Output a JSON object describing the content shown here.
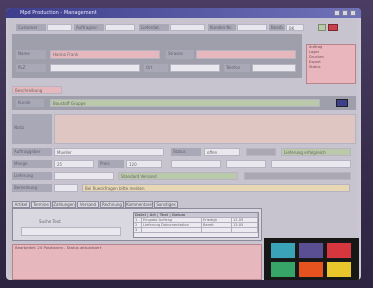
{
  "window": {
    "title": "Mpd Production - Management"
  },
  "top_row": {
    "c1_label": "Customer",
    "c1_value": "",
    "c2_label": "Auftragsnr.",
    "c2_value": "",
    "c3_label": "Lieferdat.",
    "c3_value": "",
    "c4_label": "Kunden-Nr.",
    "c4_value": "",
    "c5_label": "Bearb.",
    "c5_value": "BK"
  },
  "addr": {
    "name_label": "Name",
    "name_value": "Hanna Frank",
    "strasse_label": "Strasse",
    "plz_label": "PLZ",
    "ort_label": "Ort",
    "telefon_label": "Telefon",
    "fax_label": "Fax",
    "email_label": "E-Mail"
  },
  "ribbon_items": [
    "Auftrag",
    "Lager",
    "Drucken",
    "Export",
    "Status"
  ],
  "section": {
    "header": "Beschreibung",
    "kunde_label": "Kunde",
    "kunde_value": "Baustoff Gruppe"
  },
  "notes_label": "Notiz",
  "details": {
    "r1_label": "Auftraggeber",
    "r1_value": "Mueller",
    "r2_label": "Status",
    "r2_value": "offen",
    "r3_label": "Menge",
    "r3_value": "25",
    "r4_label": "Preis",
    "r4_value": "120",
    "r5_label": "Lieferung",
    "r5_value": "Standard Versand",
    "green_value": "Lieferung erfolgreich",
    "r6_label": "Hinweis",
    "r6_value": "Bei Rueckfragen bitte melden",
    "r7_label": "Bemerkung",
    "r7_value": ""
  },
  "tabs": [
    "Artikel",
    "Termine",
    "Zahlungen",
    "Versand",
    "Rechnung",
    "Kommentare",
    "Sonstiges"
  ],
  "tab_content": {
    "label": "Suche Text",
    "value": ""
  },
  "grid": {
    "header": "Datei | Art | Text | Datum",
    "rows": [
      [
        "1",
        "Eingabe Auftrag",
        "Erledigt",
        "12.05"
      ],
      [
        "2",
        "Lieferung Dokumentation",
        "Bereit",
        "13.05"
      ],
      [
        "3",
        "",
        "",
        ""
      ]
    ]
  },
  "footer": {
    "text": "Bearbeitet: 20 Positionen - Status aktualisiert",
    "buttons": [
      "",
      "",
      "",
      "",
      "",
      ""
    ]
  },
  "colors": {
    "accent": "#3d3e8c",
    "pink": "#e6b8be",
    "green": "#b9c9aa"
  }
}
